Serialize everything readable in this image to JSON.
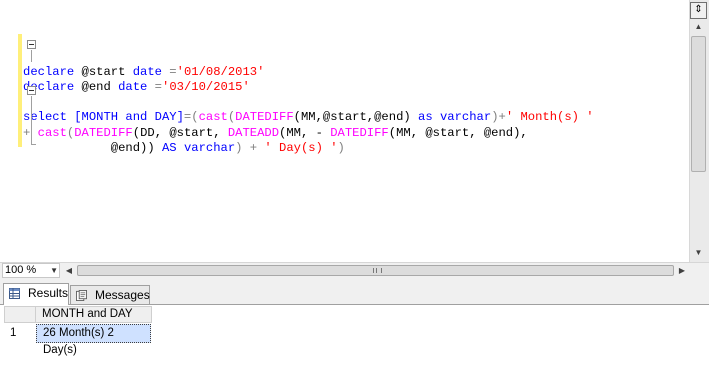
{
  "editor": {
    "lines": [
      [],
      [],
      [
        {
          "t": "declare",
          "c": "kw"
        },
        {
          "t": " @start ",
          "c": "var"
        },
        {
          "t": "date",
          "c": "kw"
        },
        {
          "t": " =",
          "c": "op"
        },
        {
          "t": "'01/08/2013'",
          "c": "str"
        }
      ],
      [
        {
          "t": "declare",
          "c": "kw"
        },
        {
          "t": " @end ",
          "c": "var"
        },
        {
          "t": "date",
          "c": "kw"
        },
        {
          "t": " =",
          "c": "op"
        },
        {
          "t": "'03/10/2015'",
          "c": "str"
        }
      ],
      [],
      [
        {
          "t": "select",
          "c": "kw"
        },
        {
          "t": " [MONTH and DAY]",
          "c": "kw"
        },
        {
          "t": "=(",
          "c": "op"
        },
        {
          "t": "cast",
          "c": "fn"
        },
        {
          "t": "(",
          "c": "op"
        },
        {
          "t": "DATEDIFF",
          "c": "fn"
        },
        {
          "t": "(MM,@start,@end) ",
          "c": "var"
        },
        {
          "t": "as",
          "c": "kw"
        },
        {
          "t": " ",
          "c": "var"
        },
        {
          "t": "varchar",
          "c": "kw"
        },
        {
          "t": ")+",
          "c": "op"
        },
        {
          "t": "' Month(s) '",
          "c": "str"
        }
      ],
      [
        {
          "t": "+ ",
          "c": "op"
        },
        {
          "t": "cast",
          "c": "fn"
        },
        {
          "t": "(",
          "c": "op"
        },
        {
          "t": "DATEDIFF",
          "c": "fn"
        },
        {
          "t": "(DD, @start, ",
          "c": "var"
        },
        {
          "t": "DATEADD",
          "c": "fn"
        },
        {
          "t": "(MM, - ",
          "c": "var"
        },
        {
          "t": "DATEDIFF",
          "c": "fn"
        },
        {
          "t": "(MM, @start, @end),",
          "c": "var"
        }
      ],
      [
        {
          "t": "            @end)) ",
          "c": "var"
        },
        {
          "t": "AS",
          "c": "kw"
        },
        {
          "t": " ",
          "c": "var"
        },
        {
          "t": "varchar",
          "c": "kw"
        },
        {
          "t": ") + ",
          "c": "op"
        },
        {
          "t": "' Day(s) '",
          "c": "str"
        },
        {
          "t": ")",
          "c": "op"
        }
      ]
    ]
  },
  "zoom": {
    "value": "100 %"
  },
  "tabs": {
    "results": "Results",
    "messages": "Messages"
  },
  "grid": {
    "column": "MONTH and DAY",
    "row_number": "1",
    "cell": "26 Month(s) 2 Day(s)"
  }
}
